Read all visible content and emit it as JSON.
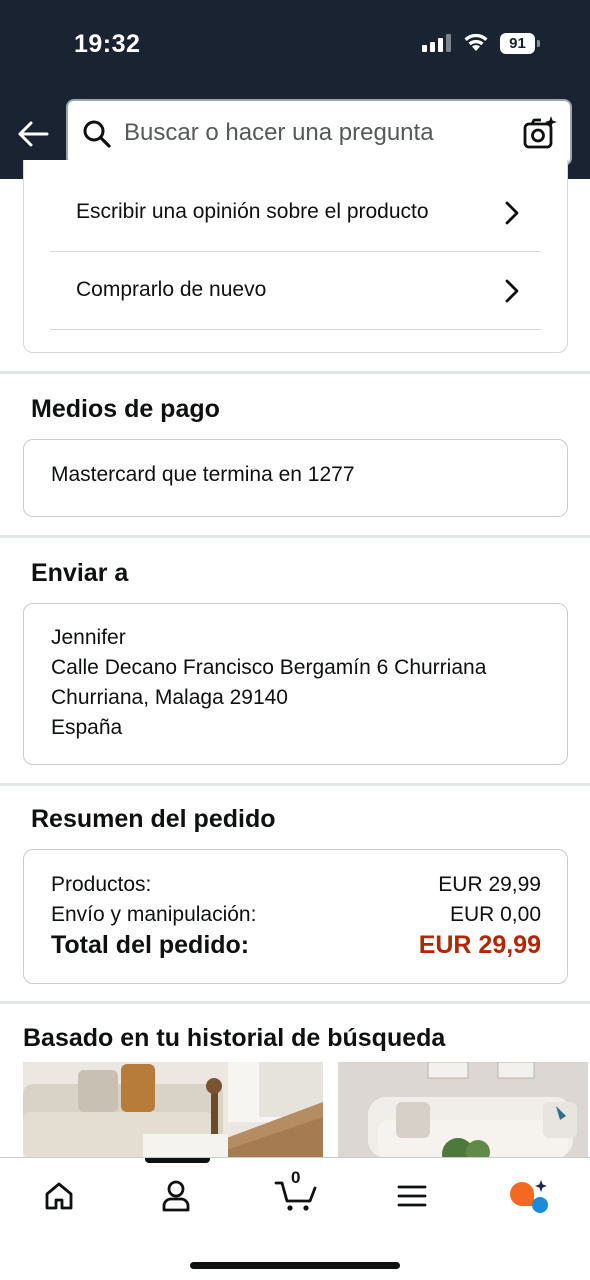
{
  "status_bar": {
    "time": "19:32",
    "battery": "91"
  },
  "search": {
    "placeholder": "Buscar o hacer una pregunta"
  },
  "order_actions": [
    {
      "label": "Escribir una opinión sobre el producto"
    },
    {
      "label": "Comprarlo de nuevo"
    }
  ],
  "payment": {
    "title": "Medios de pago",
    "method": "Mastercard  que termina en 1277"
  },
  "shipping": {
    "title": "Enviar a",
    "lines": [
      "Jennifer",
      "Calle Decano Francisco Bergamín 6 Churriana",
      "Churriana, Malaga 29140",
      "España"
    ]
  },
  "summary": {
    "title": "Resumen del pedido",
    "rows": [
      {
        "label": "Productos:",
        "value": "EUR 29,99"
      },
      {
        "label": "Envío y manipulación:",
        "value": "EUR 0,00"
      }
    ],
    "total_label": "Total del pedido:",
    "total_value": "EUR 29,99",
    "total_color": "#b12704"
  },
  "recommendations": {
    "title": "Basado en tu historial de búsqueda"
  },
  "bottom_nav": {
    "items": [
      "home-icon",
      "account-icon",
      "cart-icon",
      "menu-icon",
      "rufus-icon"
    ],
    "cart_count": "0"
  }
}
